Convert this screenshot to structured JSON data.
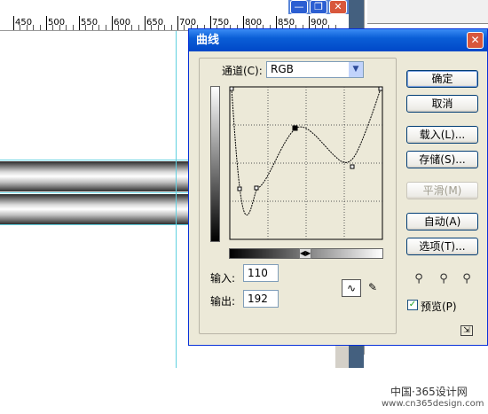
{
  "background": {
    "ruler_labels": [
      "450",
      "500",
      "550",
      "600",
      "650",
      "700",
      "750",
      "800",
      "850",
      "900"
    ],
    "window_buttons": {
      "minimize": "—",
      "restore": "❐",
      "close": "✕"
    }
  },
  "dialog": {
    "title": "曲线",
    "close_glyph": "✕",
    "channel_label": "通道(C):",
    "channel_value": "RGB",
    "input_label": "输入:",
    "input_value": "110",
    "output_label": "输出:",
    "output_value": "192",
    "buttons": {
      "ok": "确定",
      "cancel": "取消",
      "load": "载入(L)...",
      "save": "存储(S)...",
      "smooth": "平滑(M)",
      "auto": "自动(A)",
      "options": "选项(T)..."
    },
    "preview_label": "预览(P)",
    "preview_checked": true,
    "icons": {
      "curve_tool": "∿",
      "pencil_tool": "✎",
      "eyedropper": "⚲",
      "channel_arrow": "▼",
      "toggle": "◀▶",
      "resize": "⇲"
    }
  },
  "watermark": {
    "line1": "中国·365设计网",
    "line2": "www.cn365design.com"
  },
  "colors": {
    "titlebar": "#0a5ed6",
    "dialog_bg": "#ece9d8",
    "graph_bg": "#ece9d8",
    "guide": "#5fd0e0"
  }
}
